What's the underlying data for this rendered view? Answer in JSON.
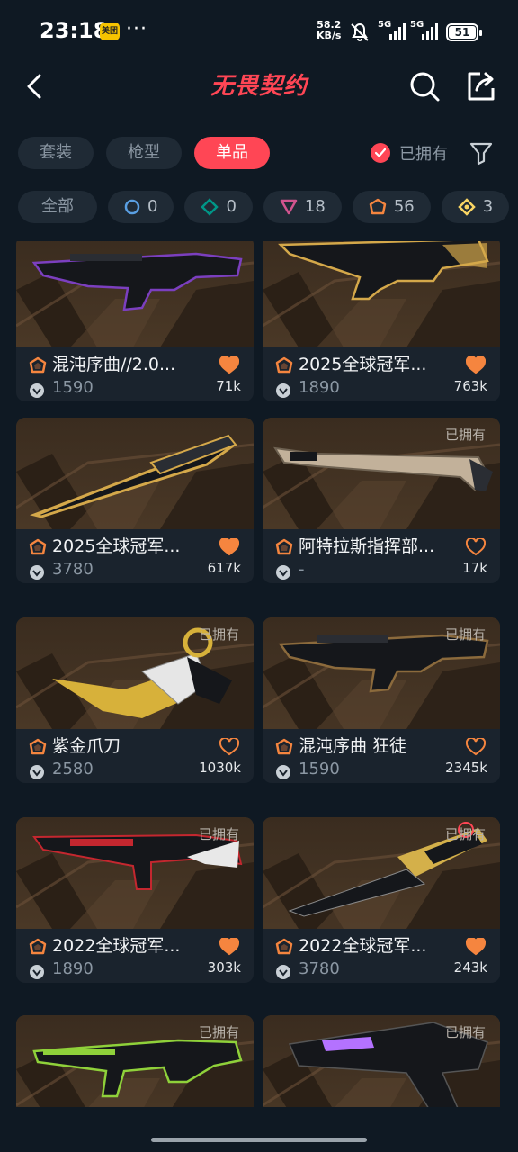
{
  "status_bar": {
    "time": "23:18",
    "app_badge": "美团",
    "dots": "···",
    "net_speed_value": "58.2",
    "net_speed_unit": "KB/s",
    "signal1_label": "5G",
    "signal2_label": "5G",
    "battery": "51"
  },
  "header": {
    "logo_text": "无畏契约",
    "back_icon": "chevron-left-icon",
    "search_icon": "search-icon",
    "share_icon": "share-icon"
  },
  "tabs": [
    {
      "label": "套装",
      "active": false
    },
    {
      "label": "枪型",
      "active": false
    },
    {
      "label": "单品",
      "active": true
    }
  ],
  "owned_filter": {
    "label": "已拥有",
    "checked": true
  },
  "rarity_chips": [
    {
      "label": "全部",
      "count": "",
      "tier": "all"
    },
    {
      "label": "",
      "count": "0",
      "tier": "select"
    },
    {
      "label": "",
      "count": "0",
      "tier": "deluxe"
    },
    {
      "label": "",
      "count": "18",
      "tier": "premium"
    },
    {
      "label": "",
      "count": "56",
      "tier": "exclusive"
    },
    {
      "label": "",
      "count": "3",
      "tier": "ultra"
    }
  ],
  "colors": {
    "accent": "#ff4655",
    "background": "#0f1923",
    "card": "#1a232d",
    "heart": "#f5853f",
    "exclusive": "#f5853f",
    "premium": "#d1548e",
    "deluxe": "#009587",
    "select": "#5a9fe2",
    "ultra": "#f9d563"
  },
  "owned_label": "已拥有",
  "items": [
    {
      "name": "混沌序曲//2.0...",
      "price": "1590",
      "likes": "71k",
      "owned": false,
      "liked": true,
      "weapon": "rifle",
      "accent": "#7b3fbf"
    },
    {
      "name": "2025全球冠军...",
      "price": "1890",
      "likes": "763k",
      "owned": false,
      "liked": true,
      "weapon": "smg",
      "accent": "#d4a84a"
    },
    {
      "name": "2025全球冠军...",
      "price": "3780",
      "likes": "617k",
      "owned": false,
      "liked": true,
      "weapon": "knife",
      "accent": "#d4a84a"
    },
    {
      "name": "阿特拉斯指挥部...",
      "price": "-",
      "likes": "17k",
      "owned": true,
      "liked": false,
      "weapon": "sword",
      "accent": "#c9b9a4"
    },
    {
      "name": "紫金爪刀",
      "price": "2580",
      "likes": "1030k",
      "owned": true,
      "liked": false,
      "weapon": "karambit",
      "accent": "#d7b13a"
    },
    {
      "name": "混沌序曲 狂徒",
      "price": "1590",
      "likes": "2345k",
      "owned": true,
      "liked": false,
      "weapon": "rifle2",
      "accent": "#8b6a3c"
    },
    {
      "name": "2022全球冠军...",
      "price": "1890",
      "likes": "303k",
      "owned": true,
      "liked": true,
      "weapon": "shotgun",
      "accent": "#c4272f"
    },
    {
      "name": "2022全球冠军...",
      "price": "3780",
      "likes": "243k",
      "owned": true,
      "liked": true,
      "weapon": "blade",
      "accent": "#d4b04a"
    },
    {
      "name": "",
      "price": "",
      "likes": "",
      "owned": true,
      "liked": false,
      "weapon": "rifle3",
      "accent": "#8fd13a"
    },
    {
      "name": "",
      "price": "",
      "likes": "",
      "owned": true,
      "liked": false,
      "weapon": "pistol",
      "accent": "#b472ff"
    }
  ]
}
